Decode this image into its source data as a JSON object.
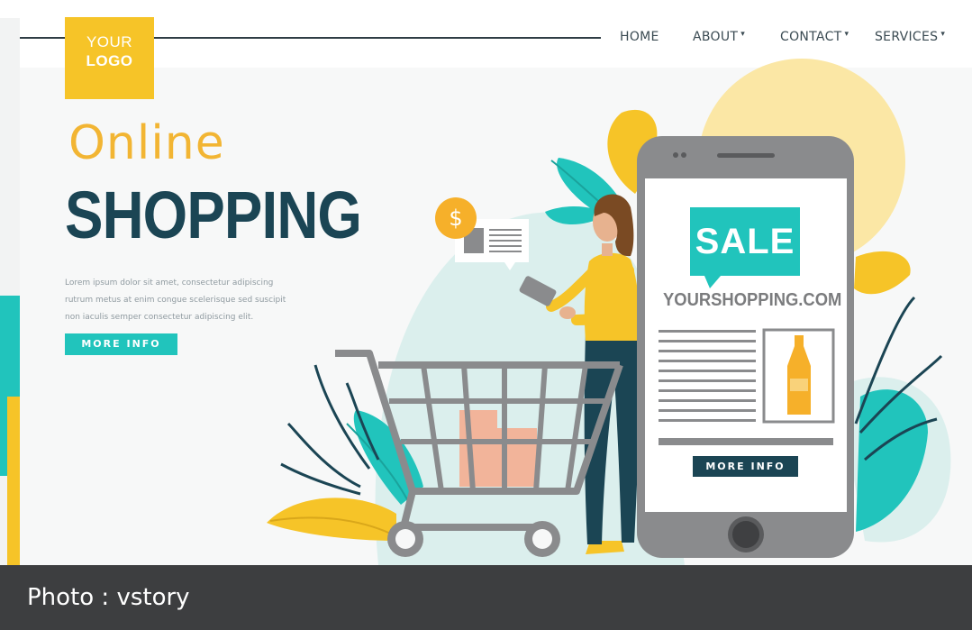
{
  "logo": {
    "line1": "YOUR",
    "line2": "LOGO"
  },
  "nav": {
    "items": [
      {
        "label": "HOME",
        "has_dropdown": false
      },
      {
        "label": "ABOUT",
        "has_dropdown": true
      },
      {
        "label": "CONTACT",
        "has_dropdown": true
      },
      {
        "label": "SERVICES",
        "has_dropdown": true
      }
    ],
    "dropdown_glyph": "▾"
  },
  "hero": {
    "title_line1": "Online",
    "title_line2": "SHOPPING",
    "body_lines": [
      "Lorem ipsum dolor sit amet, consectetur adipiscing",
      "rutrum metus at enim congue scelerisque sed suscipit",
      "non iaculis semper consectetur adipiscing elit."
    ],
    "cta_label": "MORE INFO"
  },
  "phone": {
    "sale_label": "SALE",
    "site": "YOURSHOPPING.COM",
    "cta_label": "MORE INFO"
  },
  "illustration": {
    "price_tag_symbol": "$",
    "icons": [
      "shopping-cart-icon",
      "smartphone-icon",
      "dollar-coin-icon",
      "product-bottle-icon",
      "leaf-icon"
    ]
  },
  "caption": {
    "text": "Photo : vstory"
  },
  "colors": {
    "teal": "#21c4bc",
    "navy": "#1b4554",
    "yellow": "#f6c428",
    "orange_title": "#f2b533",
    "phone_gray": "#7b7c7e",
    "caption_bg": "#3d3e40"
  }
}
